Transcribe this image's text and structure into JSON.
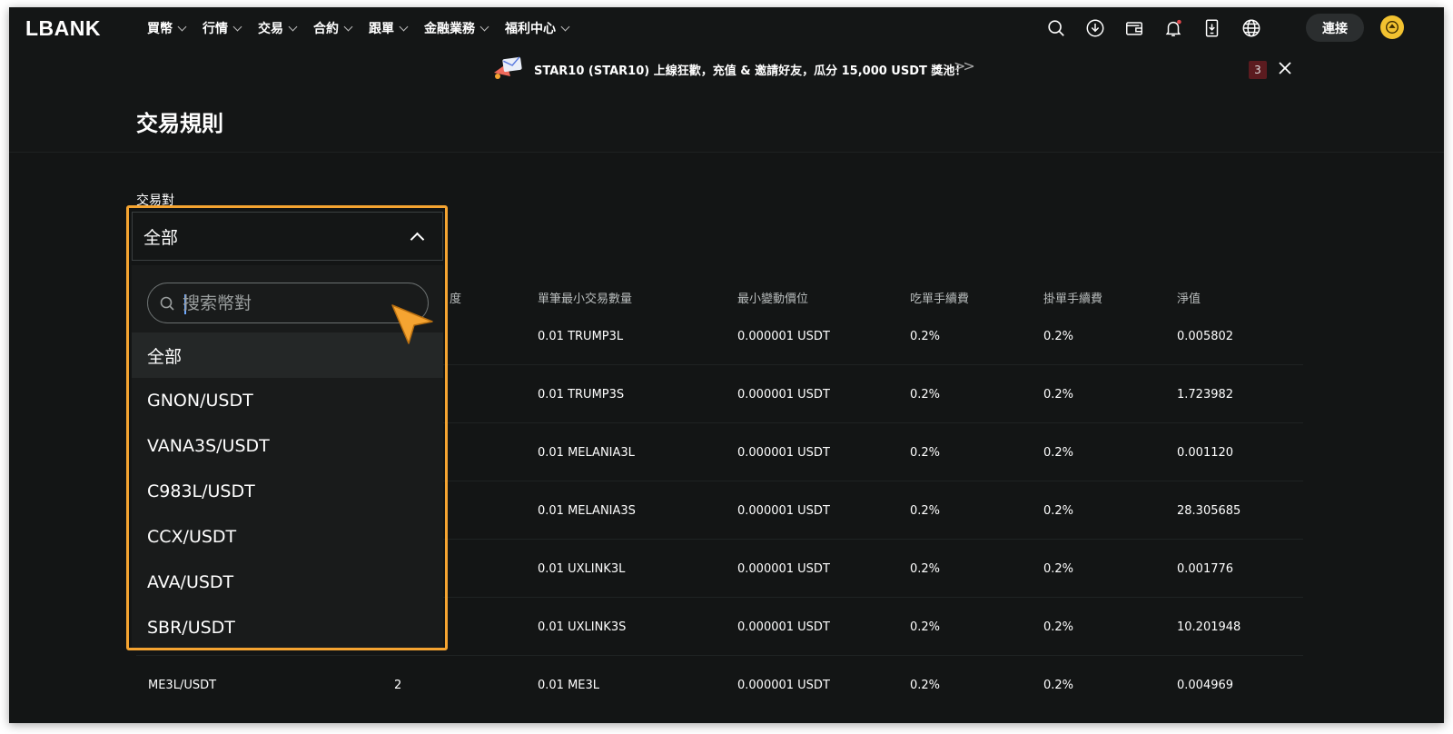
{
  "nav": {
    "logo": "LBANK",
    "menu": [
      {
        "label": "買幣"
      },
      {
        "label": "行情"
      },
      {
        "label": "交易"
      },
      {
        "label": "合約"
      },
      {
        "label": "跟單"
      },
      {
        "label": "金融業務"
      },
      {
        "label": "福利中心"
      }
    ],
    "icons": [
      "search-icon",
      "download-icon",
      "wallet-icon",
      "bell-icon",
      "app-download-icon",
      "globe-icon"
    ],
    "connect_label": "連接",
    "notification_dot_color": "#e5484d"
  },
  "banner": {
    "text": "STAR10 (STAR10) 上線狂歡，充值 & 邀請好友，瓜分 15,000 USDT 獎池！",
    "more": ">>",
    "count": "3"
  },
  "page": {
    "title": "交易規則",
    "field_label": "交易對"
  },
  "dropdown": {
    "selected": "全部",
    "search_placeholder": "搜索幣對",
    "options": [
      "全部",
      "GNON/USDT",
      "VANA3S/USDT",
      "C983L/USDT",
      "CCX/USDT",
      "AVA/USDT",
      "SBR/USDT"
    ],
    "highlight_color": "#f5a431"
  },
  "table": {
    "columns": [
      "度",
      "單筆最小交易數量",
      "最小變動價位",
      "吃單手續費",
      "掛單手續費",
      "淨值"
    ],
    "rows": [
      {
        "pair": "",
        "precision": "",
        "min_qty": "0.01 TRUMP3L",
        "tick": "0.000001 USDT",
        "taker": "0.2%",
        "maker": "0.2%",
        "nav": "0.005802"
      },
      {
        "pair": "",
        "precision": "",
        "min_qty": "0.01 TRUMP3S",
        "tick": "0.000001 USDT",
        "taker": "0.2%",
        "maker": "0.2%",
        "nav": "1.723982"
      },
      {
        "pair": "",
        "precision": "",
        "min_qty": "0.01 MELANIA3L",
        "tick": "0.000001 USDT",
        "taker": "0.2%",
        "maker": "0.2%",
        "nav": "0.001120"
      },
      {
        "pair": "",
        "precision": "",
        "min_qty": "0.01 MELANIA3S",
        "tick": "0.000001 USDT",
        "taker": "0.2%",
        "maker": "0.2%",
        "nav": "28.305685"
      },
      {
        "pair": "",
        "precision": "",
        "min_qty": "0.01 UXLINK3L",
        "tick": "0.000001 USDT",
        "taker": "0.2%",
        "maker": "0.2%",
        "nav": "0.001776"
      },
      {
        "pair": "",
        "precision": "",
        "min_qty": "0.01 UXLINK3S",
        "tick": "0.000001 USDT",
        "taker": "0.2%",
        "maker": "0.2%",
        "nav": "10.201948"
      },
      {
        "pair": "ME3L/USDT",
        "precision": "2",
        "min_qty": "0.01 ME3L",
        "tick": "0.000001 USDT",
        "taker": "0.2%",
        "maker": "0.2%",
        "nav": "0.004969"
      }
    ]
  }
}
